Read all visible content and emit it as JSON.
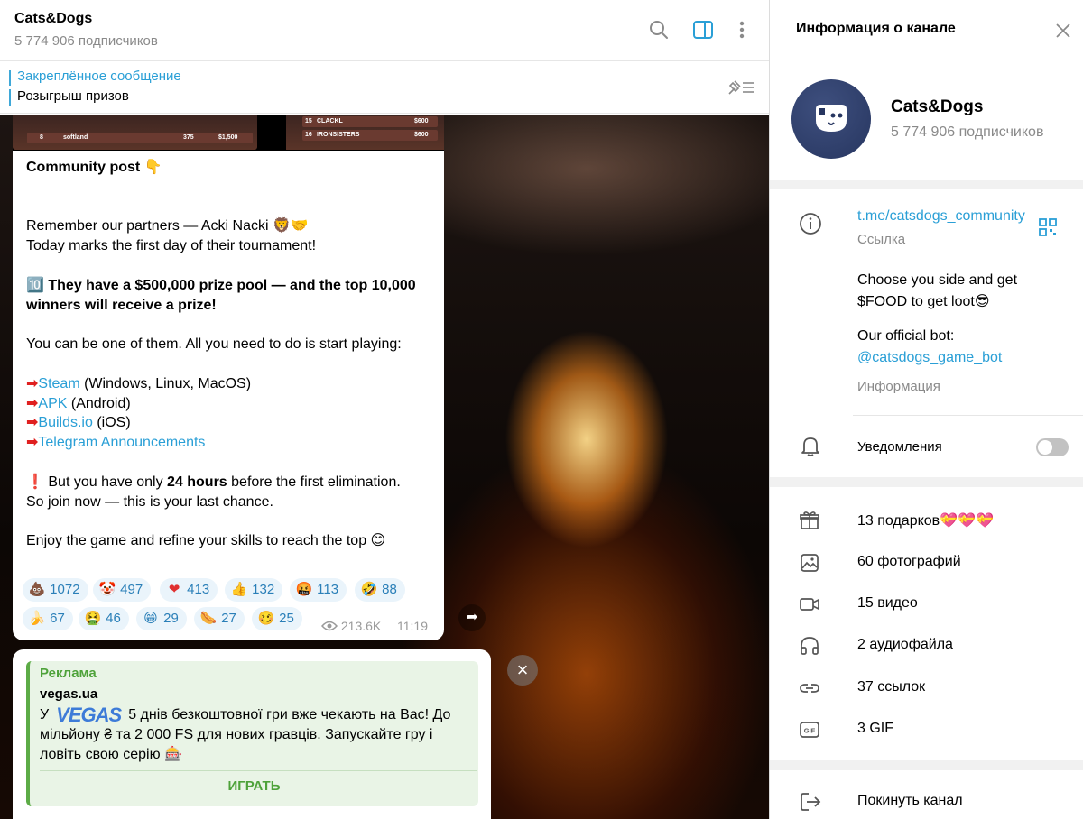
{
  "chat": {
    "title": "Cats&Dogs",
    "subscribers": "5 774 906 подписчиков",
    "pinned_title": "Закреплённое сообщение",
    "pinned_text": "Розыгрыш призов"
  },
  "message": {
    "leaderboard_rows": [
      {
        "rank": "8",
        "name": "softland",
        "score": "375",
        "prize": "$1,500"
      },
      {
        "rank": "15",
        "name": "CLACKL",
        "prize": "$600"
      },
      {
        "rank": "16",
        "name": "IRONSISTERS",
        "prize": "$600"
      }
    ],
    "line1": "Community post 👇",
    "line2": "Remember our partners — Acki Nacki 🦁🤝",
    "line3": "Today marks the first day of their tournament!",
    "line4_icon": "🔟",
    "line4_bold": "They have a $500,000 prize pool — and the top 10,000 winners will receive a prize!",
    "line5": "You can be one of them. All you need to do is start playing:",
    "links": [
      {
        "arrow": "➡",
        "text": "Steam",
        "suffix": " (Windows, Linux, MacOS)"
      },
      {
        "arrow": "➡",
        "text": "APK",
        "suffix": " (Android)"
      },
      {
        "arrow": "➡",
        "text": "Builds.io",
        "suffix": " (iOS)"
      },
      {
        "arrow": "➡",
        "text": "Telegram Announcements",
        "suffix": ""
      }
    ],
    "line6_icon": "❗",
    "line6_pre": " But you have only ",
    "line6_bold": "24 hours",
    "line6_post": " before the first elimination.",
    "line7": "So join now — this is your last chance.",
    "line8": "Enjoy the game and refine your skills to reach the top 😊",
    "reactions": [
      {
        "emoji": "💩",
        "count": "1072"
      },
      {
        "emoji": "🤡",
        "count": "497"
      },
      {
        "emoji": "❤",
        "count": "413"
      },
      {
        "emoji": "👍",
        "count": "132"
      },
      {
        "emoji": "🤬",
        "count": "113"
      },
      {
        "emoji": "🤣",
        "count": "88"
      },
      {
        "emoji": "🍌",
        "count": "67"
      },
      {
        "emoji": "🤮",
        "count": "46"
      },
      {
        "emoji": "😁",
        "count": "29"
      },
      {
        "emoji": "🌭",
        "count": "27"
      },
      {
        "emoji": "🥴",
        "count": "25"
      }
    ],
    "views": "213.6K",
    "time": "11:19"
  },
  "ad": {
    "label": "Реклама",
    "site": "vegas.ua",
    "text_pre": "У",
    "logo_text": "VEGAS",
    "text_post": "5 днів безкоштовної гри вже чекають на Вас! До мільйону ₴ та 2 000 FS для нових гравців. Запускайте гру і ловіть свою серію 🎰",
    "button": "ИГРАТЬ"
  },
  "info": {
    "title": "Информация о канале",
    "name": "Cats&Dogs",
    "subscribers": "5 774 906 подписчиков",
    "link": "t.me/catsdogs_community",
    "link_label": "Ссылка",
    "desc_line1": "Choose you side and get $FOOD to get loot😎",
    "desc_line2": "Our official bot:",
    "bot": "@catsdogs_game_bot",
    "desc_label": "Информация",
    "notifications": "Уведомления",
    "notifications_on": false,
    "media": [
      {
        "icon": "gift-icon",
        "label": "13 подарков",
        "extra": "💝💝💝"
      },
      {
        "icon": "photo-icon",
        "label": "60 фотографий",
        "extra": ""
      },
      {
        "icon": "video-icon",
        "label": "15 видео",
        "extra": ""
      },
      {
        "icon": "headphones-icon",
        "label": "2 аудиофайла",
        "extra": ""
      },
      {
        "icon": "link-icon",
        "label": "37 ссылок",
        "extra": ""
      },
      {
        "icon": "gif-icon",
        "label": "3 GIF",
        "extra": ""
      }
    ],
    "leave": "Покинуть канал"
  }
}
